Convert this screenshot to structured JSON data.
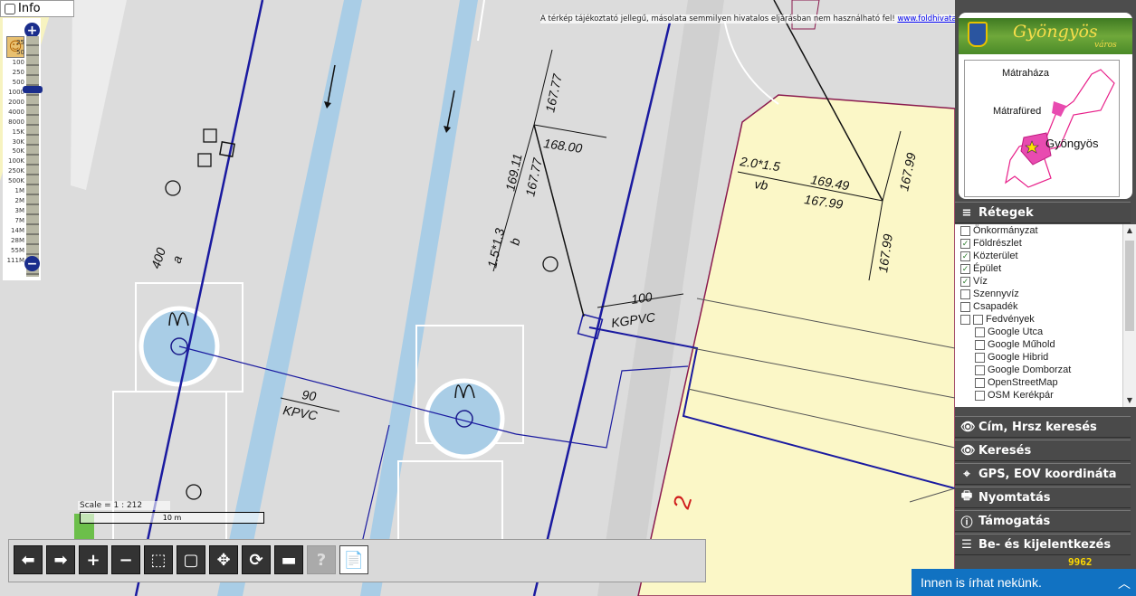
{
  "info": {
    "label": "Info"
  },
  "zoom": {
    "levels": [
      "25",
      "50",
      "100",
      "250",
      "500",
      "1000",
      "2000",
      "4000",
      "8000",
      "15K",
      "30K",
      "50K",
      "100K",
      "250K",
      "500K",
      "1M",
      "2M",
      "3M",
      "7M",
      "14M",
      "28M",
      "55M",
      "111M"
    ],
    "plus": "+",
    "minus": "−"
  },
  "disclaimer": {
    "text": "A térkép tájékoztató jellegű, másolata semmilyen hivatalos eljárásban nem használható fel! ",
    "link": "www.foldhivatal.hu"
  },
  "map_labels": {
    "l1": "167.77",
    "l2": "168.00",
    "l3": "169.11",
    "l4": "167.77",
    "l5": "1.5*1.3",
    "l6": "b",
    "l7": "2.0*1.5",
    "l8": "vb",
    "l9": "169.49",
    "l10": "167.99",
    "l11": "167.99",
    "l12": "167.99",
    "l13": "100",
    "l14": "KGPVC",
    "l15": "400",
    "l16": "a",
    "l17": "90",
    "l18": "KPVC",
    "l19": "2"
  },
  "scale": {
    "text": "Scale = 1 : 212",
    "bar": "10 m"
  },
  "toolbar": [
    {
      "name": "pan-left-button",
      "glyph": "⬅"
    },
    {
      "name": "pan-right-button",
      "glyph": "➡"
    },
    {
      "name": "zoom-in-button",
      "glyph": "+"
    },
    {
      "name": "zoom-out-button",
      "glyph": "−"
    },
    {
      "name": "zoom-box-button",
      "glyph": "⬚"
    },
    {
      "name": "full-extent-button",
      "glyph": "▢"
    },
    {
      "name": "pan-tool-button",
      "glyph": "✥"
    },
    {
      "name": "refresh-button",
      "glyph": "⟳"
    },
    {
      "name": "measure-button",
      "glyph": "▬"
    },
    {
      "name": "help-button",
      "glyph": "?"
    },
    {
      "name": "document-button",
      "glyph": "📄"
    }
  ],
  "logo": {
    "city": "Gyöngyös",
    "subtitle": "város"
  },
  "minimap": {
    "labels": [
      "Mátraháza",
      "Mátrafüred",
      "Gyöngyös"
    ]
  },
  "layers_section": {
    "title": "Rétegek"
  },
  "layers": [
    {
      "label": "Önkormányzat",
      "checked": false,
      "indent": 0
    },
    {
      "label": "Földrészlet",
      "checked": true,
      "indent": 0
    },
    {
      "label": "Közterület",
      "checked": true,
      "indent": 0
    },
    {
      "label": "Épület",
      "checked": true,
      "indent": 0
    },
    {
      "label": "Víz",
      "checked": true,
      "indent": 0
    },
    {
      "label": "Szennyvíz",
      "checked": false,
      "indent": 0
    },
    {
      "label": "Csapadék",
      "checked": false,
      "indent": 0
    },
    {
      "label": "Fedvények",
      "checked": false,
      "indent": 1
    },
    {
      "label": "Google Utca",
      "checked": false,
      "indent": 2
    },
    {
      "label": "Google Műhold",
      "checked": false,
      "indent": 2
    },
    {
      "label": "Google Hibrid",
      "checked": false,
      "indent": 2
    },
    {
      "label": "Google Domborzat",
      "checked": false,
      "indent": 2
    },
    {
      "label": "OpenStreetMap",
      "checked": false,
      "indent": 2
    },
    {
      "label": "OSM Kerékpár",
      "checked": false,
      "indent": 2
    }
  ],
  "sections": [
    {
      "title": "Cím, Hrsz keresés",
      "icon": "eye-icon",
      "glyph": "👁"
    },
    {
      "title": "Keresés",
      "icon": "eye-icon",
      "glyph": "👁"
    },
    {
      "title": "GPS, EOV koordináta",
      "icon": "crosshair-icon",
      "glyph": "⌖"
    },
    {
      "title": "Nyomtatás",
      "icon": "printer-icon",
      "glyph": "🖶"
    },
    {
      "title": "Támogatás",
      "icon": "info-icon",
      "glyph": "ⓘ"
    },
    {
      "title": "Be- és kijelentkezés",
      "icon": "login-icon",
      "glyph": "☰"
    }
  ],
  "counter": "9962",
  "chat": {
    "text": "Innen is írhat nekünk.",
    "chevron": "︿"
  }
}
